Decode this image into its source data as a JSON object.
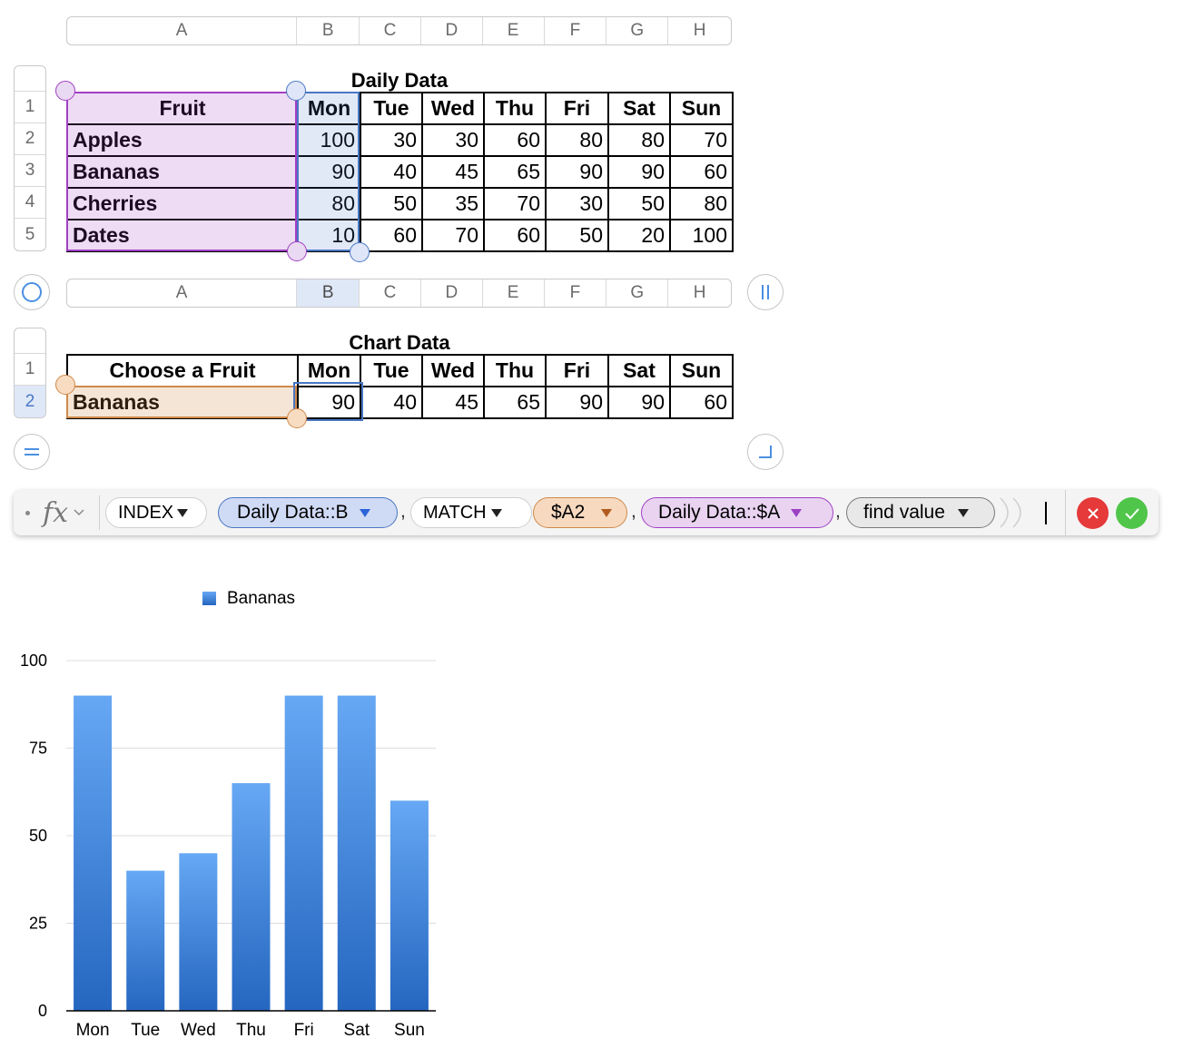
{
  "columns": [
    "A",
    "B",
    "C",
    "D",
    "E",
    "F",
    "G",
    "H"
  ],
  "daily_table": {
    "title": "Daily Data",
    "row_numbers": [
      "1",
      "2",
      "3",
      "4",
      "5"
    ],
    "header": [
      "Fruit",
      "Mon",
      "Tue",
      "Wed",
      "Thu",
      "Fri",
      "Sat",
      "Sun"
    ],
    "rows": [
      [
        "Apples",
        "100",
        "30",
        "30",
        "60",
        "80",
        "80",
        "70"
      ],
      [
        "Bananas",
        "90",
        "40",
        "45",
        "65",
        "90",
        "90",
        "60"
      ],
      [
        "Cherries",
        "80",
        "50",
        "35",
        "70",
        "30",
        "50",
        "80"
      ],
      [
        "Dates",
        "10",
        "60",
        "70",
        "60",
        "50",
        "20",
        "100"
      ]
    ]
  },
  "chart_table": {
    "title": "Chart Data",
    "row_numbers": [
      "1",
      "2"
    ],
    "header": [
      "Choose a Fruit",
      "Mon",
      "Tue",
      "Wed",
      "Thu",
      "Fri",
      "Sat",
      "Sun"
    ],
    "rows": [
      [
        "Bananas",
        "90",
        "40",
        "45",
        "65",
        "90",
        "90",
        "60"
      ]
    ]
  },
  "formula_bar": {
    "fx_label": "fx",
    "tokens": {
      "index": "INDEX",
      "daily_b": "Daily Data::B",
      "match": "MATCH",
      "a2": "$A2",
      "daily_a": "Daily Data::$A",
      "find_value": "find value"
    },
    "separator": ","
  },
  "colors": {
    "selection_blue": "#4a77c4",
    "selection_purple": "#a13fc4",
    "selection_orange": "#cf8a4b",
    "bar_top": "#66a8f4",
    "bar_bottom": "#2566c0",
    "cancel_red": "#e5393a",
    "accept_green": "#4fc54a"
  },
  "chart_data": {
    "type": "bar",
    "categories": [
      "Mon",
      "Tue",
      "Wed",
      "Thu",
      "Fri",
      "Sat",
      "Sun"
    ],
    "series": [
      {
        "name": "Bananas",
        "values": [
          90,
          40,
          45,
          65,
          90,
          90,
          60
        ]
      }
    ],
    "yticks": [
      "0",
      "25",
      "50",
      "75",
      "100"
    ],
    "ylim": [
      0,
      100
    ],
    "legend": "top"
  }
}
